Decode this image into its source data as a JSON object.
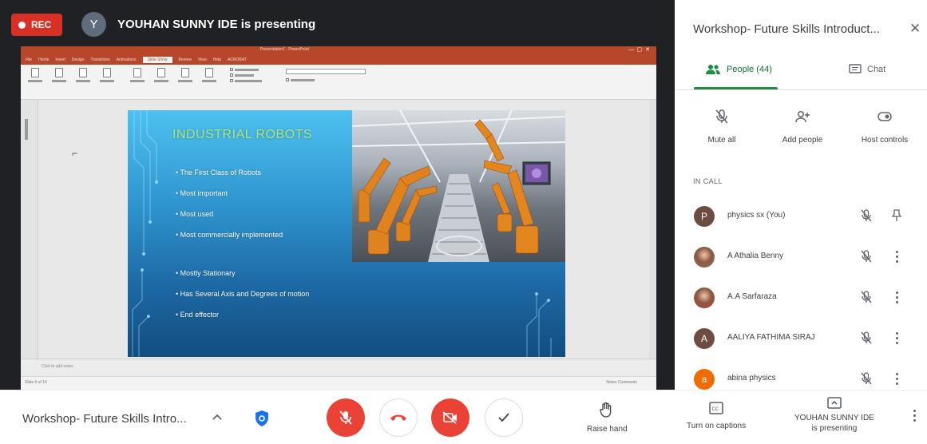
{
  "stage": {
    "rec_label": "REC",
    "presenter_initial": "Y",
    "presenter_text": "YOUHAN SUNNY IDE is presenting"
  },
  "slide": {
    "title": "INDUSTRIAL ROBOTS",
    "bullets_top": [
      "The First Class of Robots",
      "Most important",
      "Most used",
      "Most commercially implemented"
    ],
    "bullets_bottom": [
      "Mostly Stationary",
      "Has Several Axis and Degrees of motion",
      "End effector"
    ]
  },
  "ppt": {
    "title_text": "Presentation1 - PowerPoint",
    "tabs": [
      "File",
      "Home",
      "Insert",
      "Design",
      "Transitions",
      "Animations",
      "Slide Show",
      "Review",
      "View",
      "Help",
      "ACROBAT"
    ],
    "active_tab": "Slide Show",
    "notes_placeholder": "Click to add notes",
    "status_left": "Slide 6 of 14",
    "status_right": "Notes   Comments"
  },
  "sidebar": {
    "title": "Workshop- Future Skills Introduct...",
    "tabs": {
      "people": "People (44)",
      "chat": "Chat"
    },
    "actions": {
      "mute_all": "Mute all",
      "add_people": "Add people",
      "host_controls": "Host controls"
    },
    "section_label": "IN CALL",
    "participants": [
      {
        "initial": "P",
        "name": "physics sx (You)",
        "color": "#6d4c41",
        "photo": false
      },
      {
        "initial": "",
        "name": "A Athalia Benny",
        "color": "#8d6e63",
        "photo": true
      },
      {
        "initial": "",
        "name": "A.A Sarfaraza",
        "color": "#c0392b",
        "photo": true
      },
      {
        "initial": "A",
        "name": "AALIYA FATHIMA SIRAJ",
        "color": "#6d4c41",
        "photo": false
      },
      {
        "initial": "a",
        "name": "abina physics",
        "color": "#ef6c00",
        "photo": false
      }
    ]
  },
  "bottombar": {
    "meeting_title": "Workshop- Future Skills Intro...",
    "raise_hand": "Raise hand",
    "captions": "Turn on captions",
    "presenting_line1": "YOUHAN SUNNY IDE",
    "presenting_line2": "is presenting"
  },
  "colors": {
    "rec_red": "#d93025",
    "meet_red": "#ea4335",
    "meet_green": "#1e8e3e",
    "ppt_orange": "#b7472a",
    "slide_title_green": "#a8e87c"
  }
}
